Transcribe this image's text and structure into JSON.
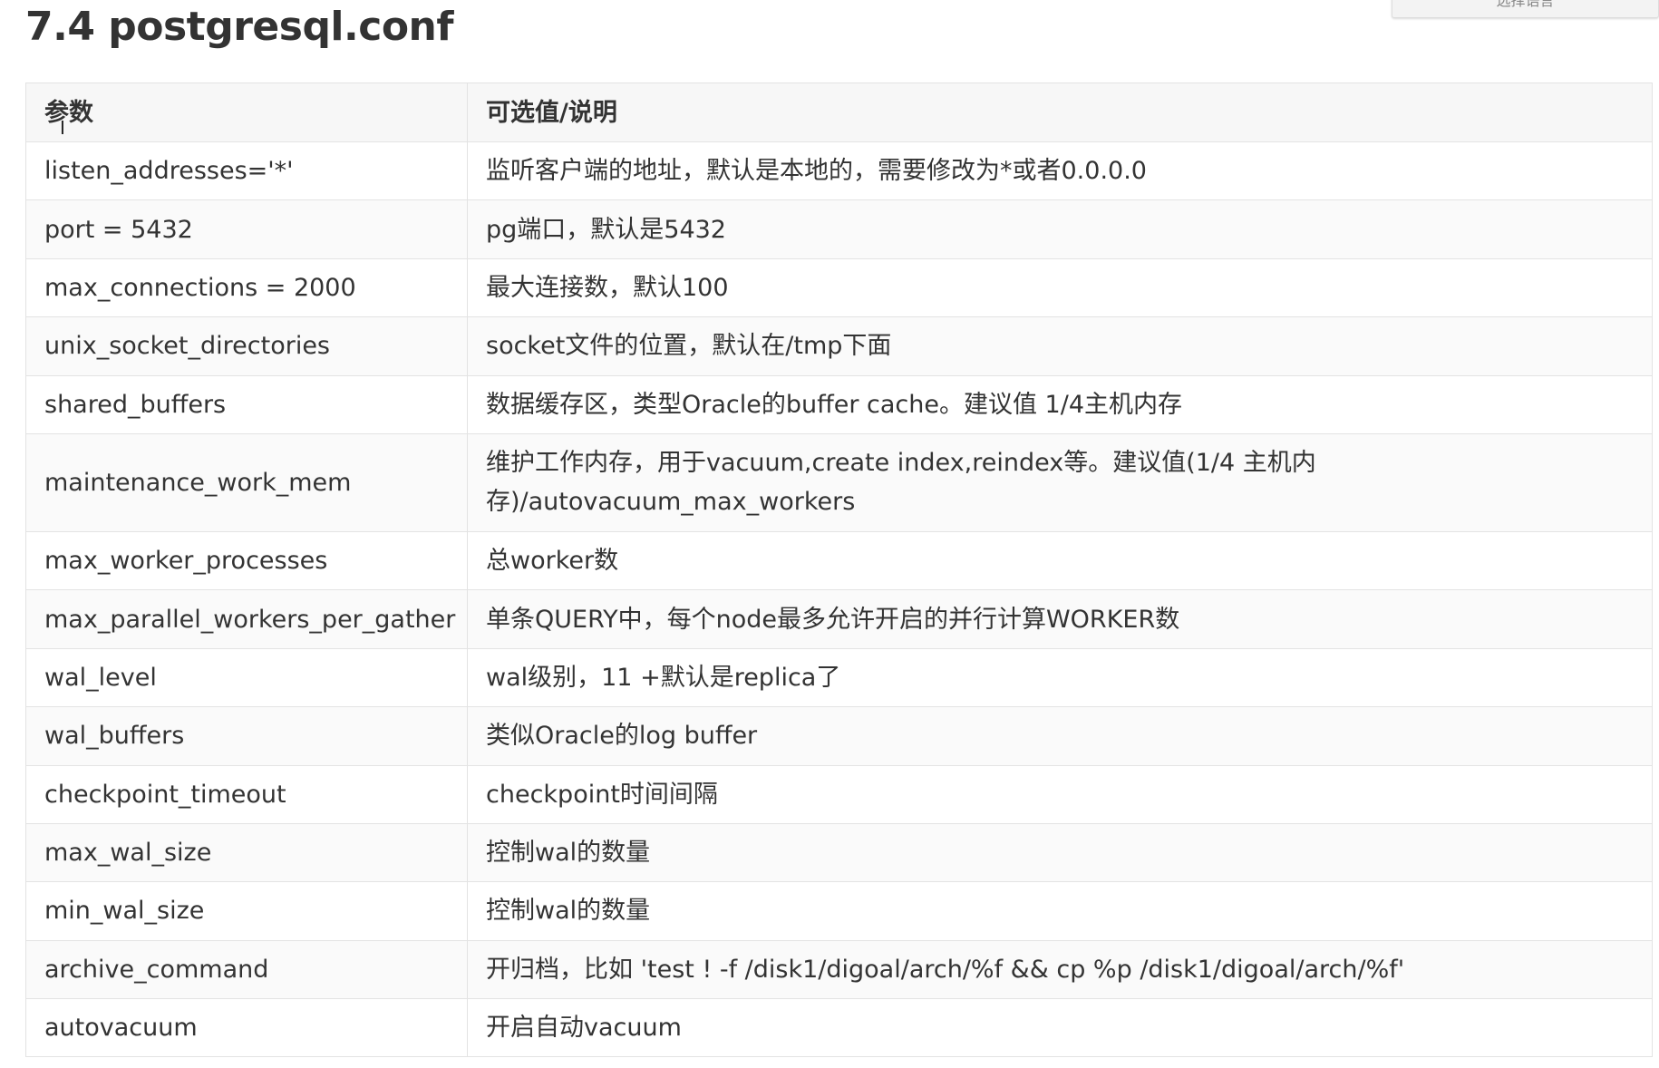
{
  "page": {
    "title": "7.4 postgresql.conf"
  },
  "language_button": {
    "label": "选择语言"
  },
  "table": {
    "headers": [
      "参数",
      "可选值/说明"
    ],
    "rows": [
      {
        "param": "listen_addresses='*'",
        "desc": "监听客户端的地址，默认是本地的，需要修改为*或者0.0.0.0"
      },
      {
        "param": "port = 5432",
        "desc": "pg端口，默认是5432"
      },
      {
        "param": "max_connections = 2000",
        "desc": "最大连接数，默认100"
      },
      {
        "param": "unix_socket_directories",
        "desc": "socket文件的位置，默认在/tmp下面"
      },
      {
        "param": "shared_buffers",
        "desc": "数据缓存区，类型Oracle的buffer cache。建议值 1/4主机内存"
      },
      {
        "param": "maintenance_work_mem",
        "desc_line1": "维护工作内存，用于vacuum,create index,reindex等。建议值(1/4 主机内",
        "desc_line2": "存)/autovacuum_max_workers"
      },
      {
        "param": "max_worker_processes",
        "desc": "总worker数"
      },
      {
        "param": "max_parallel_workers_per_gather",
        "desc": "单条QUERY中，每个node最多允许开启的并行计算WORKER数"
      },
      {
        "param": "wal_level",
        "desc": "wal级别，11 +默认是replica了"
      },
      {
        "param": "wal_buffers",
        "desc": "类似Oracle的log buffer"
      },
      {
        "param": "checkpoint_timeout",
        "desc": "checkpoint时间间隔"
      },
      {
        "param": "max_wal_size",
        "desc": "控制wal的数量"
      },
      {
        "param": "min_wal_size",
        "desc": "控制wal的数量"
      },
      {
        "param": "archive_command",
        "desc": "开归档，比如 'test ! -f /disk1/digoal/arch/%f && cp %p /disk1/digoal/arch/%f'"
      },
      {
        "param": "autovacuum",
        "desc": "开启自动vacuum"
      }
    ]
  }
}
